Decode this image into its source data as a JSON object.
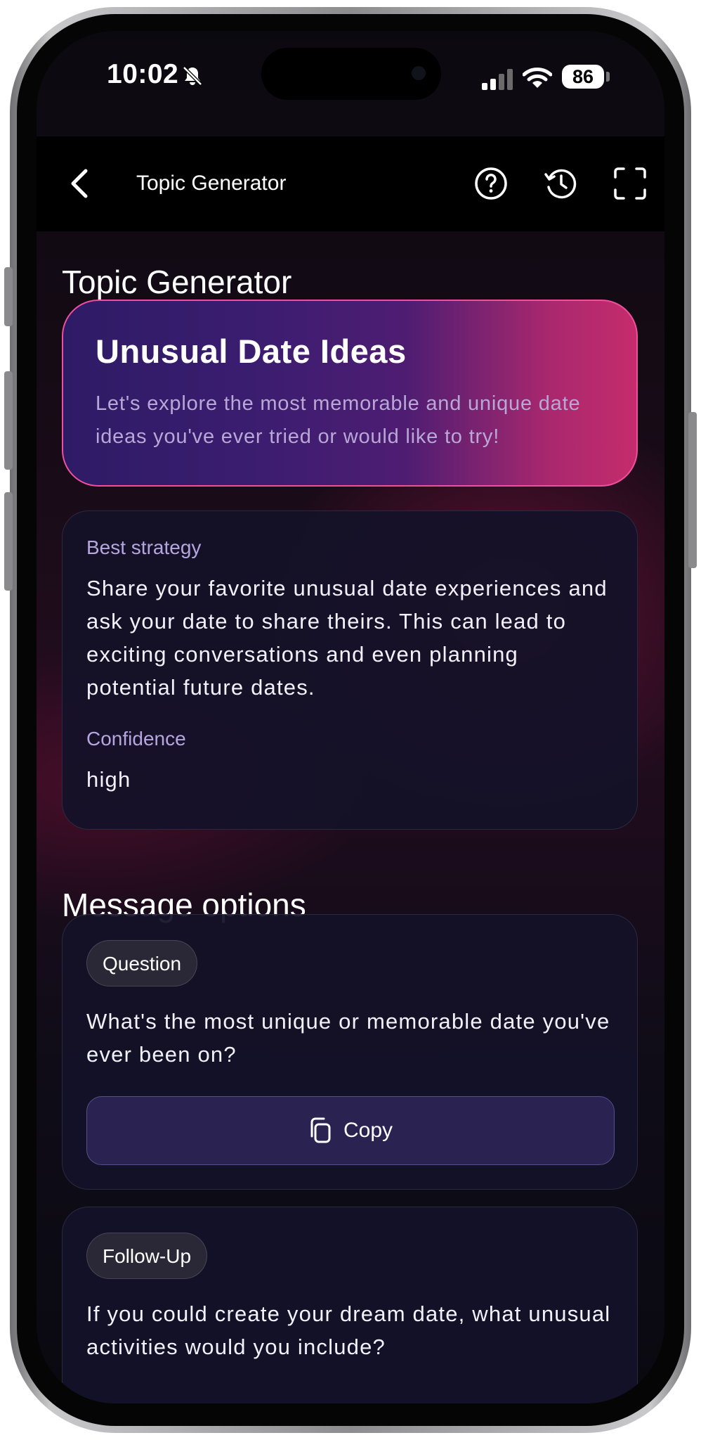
{
  "status_bar": {
    "time": "10:02",
    "battery": "86"
  },
  "nav": {
    "title": "Topic Generator"
  },
  "page": {
    "title": "Topic Generator"
  },
  "hero": {
    "title": "Unusual Date Ideas",
    "subtitle": "Let's explore the most memorable and unique date ideas you've ever tried or would like to try!"
  },
  "strategy": {
    "label": "Best strategy",
    "text": "Share your favorite unusual date experiences and ask your date to share theirs. This can lead to exciting conversations and even planning potential future dates.",
    "confidence_label": "Confidence",
    "confidence_value": "high"
  },
  "messages": {
    "section_title": "Message options",
    "items": [
      {
        "tag": "Question",
        "text": "What's the most unique or memorable date you've ever been on?",
        "copy_label": "Copy"
      },
      {
        "tag": "Follow-Up",
        "text": "If you could create your dream date, what unusual activities would you include?"
      }
    ]
  },
  "colors": {
    "accent_pink": "#ef4f9e",
    "hero_start": "#2e1b66",
    "hero_end": "#c52c6c",
    "label": "#b6a6e0"
  },
  "icons": [
    "bell-off-icon",
    "cellular-signal-icon",
    "wifi-icon",
    "battery-icon",
    "back-chevron-icon",
    "help-icon",
    "history-icon",
    "fullscreen-icon",
    "copy-icon"
  ]
}
